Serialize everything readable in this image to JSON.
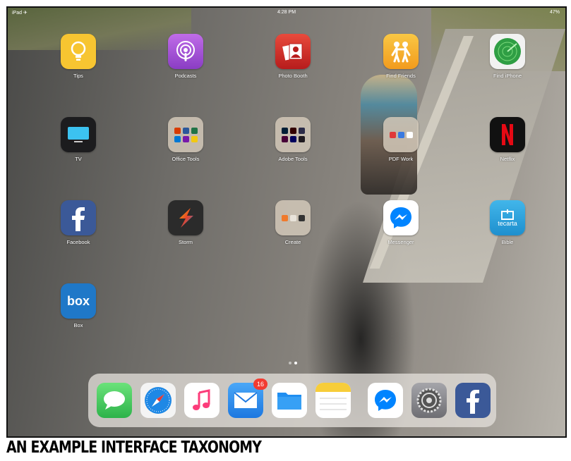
{
  "status_bar": {
    "carrier": "iPad ✈",
    "time": "4:28 PM",
    "battery": "47%"
  },
  "apps": [
    {
      "name": "tips-app",
      "label": "Tips",
      "icon": "lightbulb-icon",
      "color": "#f7c531"
    },
    {
      "name": "podcasts-app",
      "label": "Podcasts",
      "icon": "podcast-icon",
      "color": "#9b4fd0"
    },
    {
      "name": "photo-booth-app",
      "label": "Photo Booth",
      "icon": "photo-booth-icon",
      "color": "#d42a2a"
    },
    {
      "name": "find-friends-app",
      "label": "Find Friends",
      "icon": "friends-icon",
      "color": "#f5a623"
    },
    {
      "name": "find-iphone-app",
      "label": "Find iPhone",
      "icon": "radar-icon",
      "color": "#2f9e44"
    },
    {
      "name": "tv-app",
      "label": "TV",
      "icon": "tv-icon",
      "color": "#1c1c1e"
    },
    {
      "name": "office-tools-folder",
      "label": "Office Tools",
      "icon": "folder-icon",
      "color": "#d2c8b9"
    },
    {
      "name": "adobe-tools-folder",
      "label": "Adobe Tools",
      "icon": "folder-icon",
      "color": "#d2c8b9"
    },
    {
      "name": "pdf-work-folder",
      "label": "PDF Work",
      "icon": "folder-icon",
      "color": "#d2c8b9"
    },
    {
      "name": "netflix-app",
      "label": "Netflix",
      "icon": "netflix-icon",
      "color": "#111111"
    },
    {
      "name": "facebook-app",
      "label": "Facebook",
      "icon": "facebook-icon",
      "color": "#3b5998"
    },
    {
      "name": "storm-app",
      "label": "Storm",
      "icon": "storm-icon",
      "color": "#2b2b2b"
    },
    {
      "name": "create-folder",
      "label": "Create",
      "icon": "folder-icon",
      "color": "#d2c8b9"
    },
    {
      "name": "messenger-app",
      "label": "Messenger",
      "icon": "messenger-icon",
      "color": "#ffffff"
    },
    {
      "name": "bible-app",
      "label": "Bible",
      "icon": "tecarta-icon",
      "icon_text": "tecarta",
      "color": "#2b9fd8"
    },
    {
      "name": "box-app",
      "label": "Box",
      "icon": "box-icon",
      "icon_text": "box",
      "color": "#1f78c8"
    }
  ],
  "dock": [
    {
      "name": "dock-messages",
      "icon": "messages-icon",
      "color": "#34c759"
    },
    {
      "name": "dock-safari",
      "icon": "safari-icon",
      "color": "#1e88e5"
    },
    {
      "name": "dock-music",
      "icon": "music-icon",
      "color": "#ffffff"
    },
    {
      "name": "dock-mail",
      "icon": "mail-icon",
      "color": "#2f8ff0",
      "badge": "16"
    },
    {
      "name": "dock-files",
      "icon": "files-icon",
      "color": "#ffffff"
    },
    {
      "name": "dock-notes",
      "icon": "notes-icon",
      "color": "#ffffff"
    },
    {
      "name": "dock-messenger",
      "icon": "messenger-icon",
      "color": "#ffffff"
    },
    {
      "name": "dock-settings",
      "icon": "settings-icon",
      "color": "#8e8e93"
    },
    {
      "name": "dock-facebook",
      "icon": "facebook-icon",
      "color": "#3b5998"
    }
  ],
  "page_dots": {
    "count": 2,
    "active": 2
  },
  "caption": "AN EXAMPLE INTERFACE TAXONOMY"
}
